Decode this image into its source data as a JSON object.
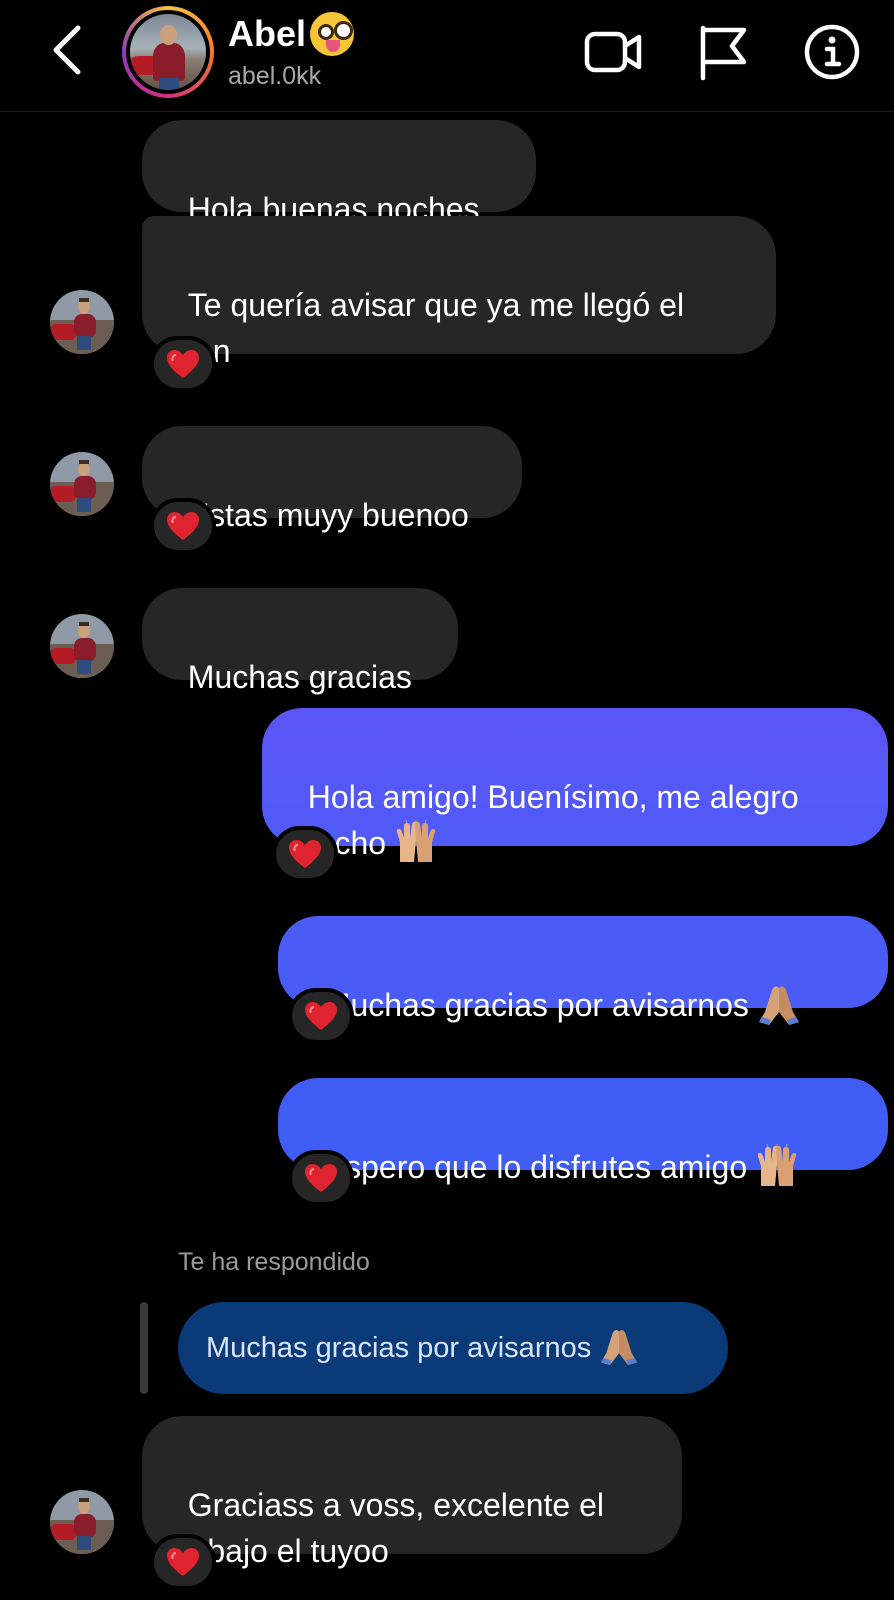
{
  "header": {
    "contact_name": "Abel",
    "contact_handle": "abel.0kk",
    "icons": [
      "back-chevron-icon",
      "video-call-icon",
      "flag-icon",
      "info-icon"
    ]
  },
  "messages": [
    {
      "id": "m1",
      "direction": "incoming",
      "text": "Hola buenas noches"
    },
    {
      "id": "m2",
      "direction": "incoming",
      "text": "Te quería avisar que ya me llegó el\njean",
      "reaction": "❤️"
    },
    {
      "id": "m3",
      "direction": "incoming",
      "text": "Estas muyy buenoo",
      "reaction": "❤️"
    },
    {
      "id": "m4",
      "direction": "incoming",
      "text": "Muchas gracias"
    },
    {
      "id": "m5",
      "direction": "outgoing",
      "text": "Hola amigo! Buenísimo, me alegro\nmucho",
      "emoji": "raising-hands",
      "reaction": "❤️"
    },
    {
      "id": "m6",
      "direction": "outgoing",
      "text": "Muchas gracias por avisarnos",
      "emoji": "folded-hands",
      "reaction": "❤️"
    },
    {
      "id": "m7",
      "direction": "outgoing",
      "text": "Espero que lo disfrutes amigo",
      "emoji": "raising-hands",
      "reaction": "❤️"
    },
    {
      "id": "m8",
      "direction": "incoming",
      "text": "Graciass a voss, excelente el\ntrabajo el tuyoo",
      "reaction": "❤️"
    }
  ],
  "reply": {
    "label": "Te ha respondido",
    "quoted_text": "Muchas gracias por avisarnos",
    "quoted_emoji": "folded-hands"
  },
  "colors": {
    "background": "#000000",
    "incoming_bubble": "#262626",
    "outgoing_top": "#5b55f6",
    "outgoing_bottom": "#3f5cf5",
    "quoted_bubble": "#0b3a78",
    "heart": "#e0242f"
  }
}
